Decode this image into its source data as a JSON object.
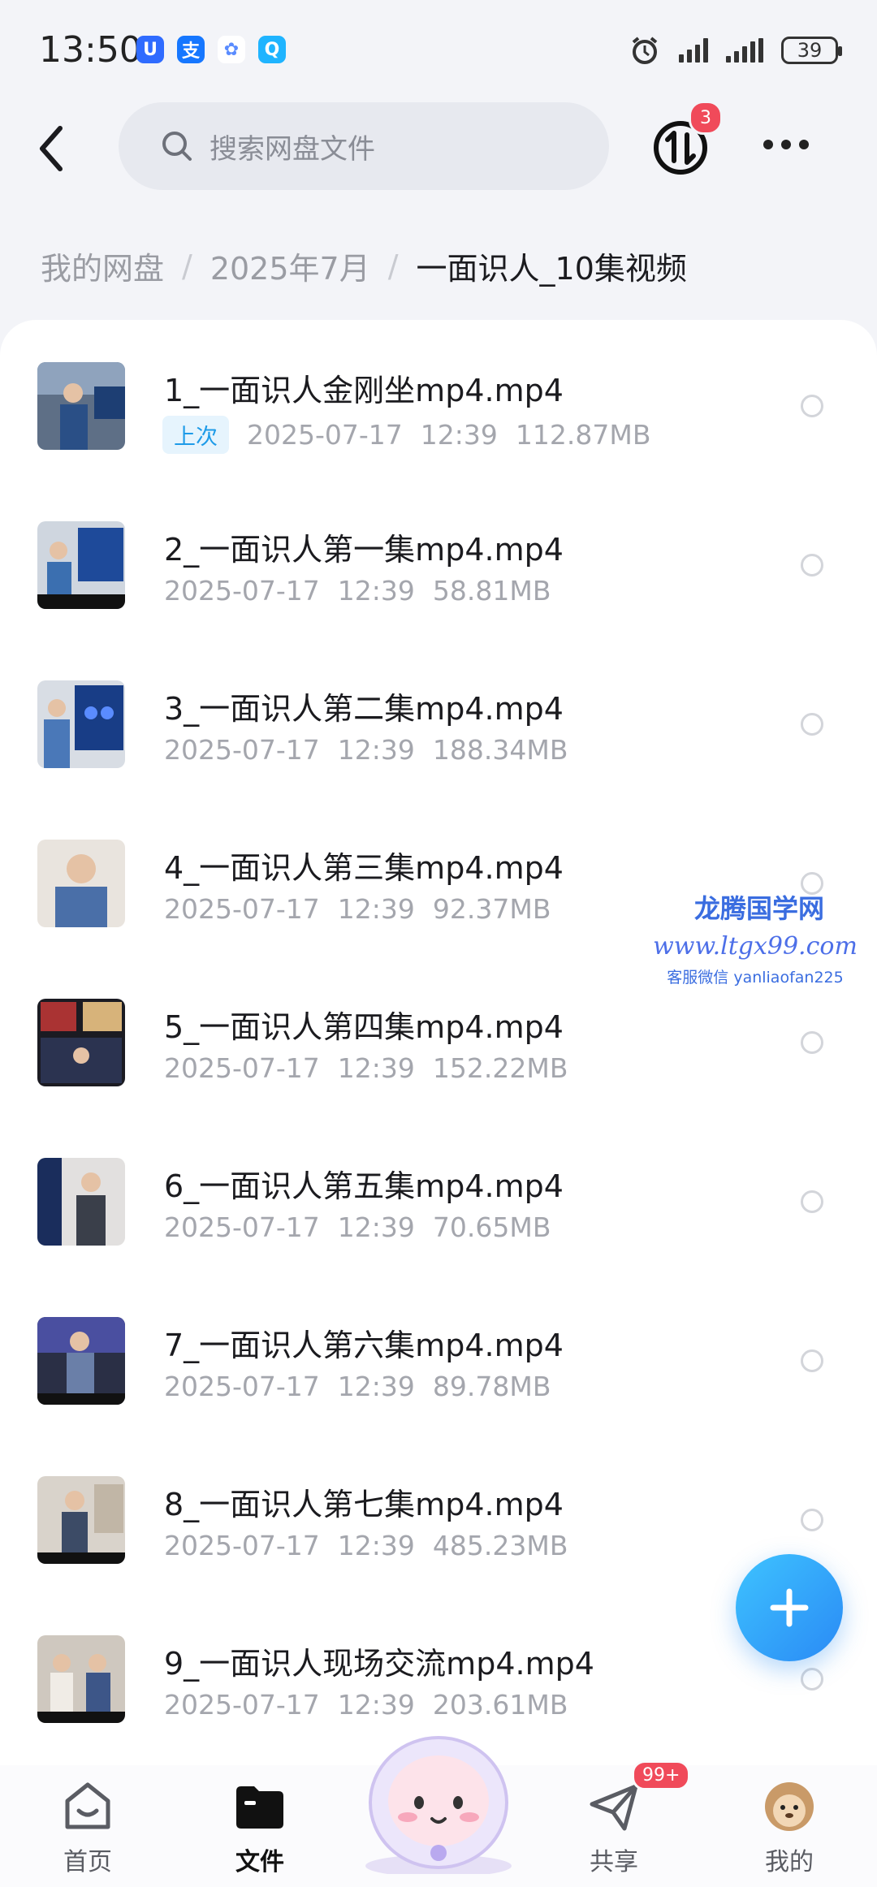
{
  "status_bar": {
    "time": "13:50",
    "app_icons": [
      {
        "name": "baidu-app-icon",
        "glyph": "U",
        "color": "#2f6bff"
      },
      {
        "name": "alipay-app-icon",
        "glyph": "支",
        "color": "#1677ff"
      },
      {
        "name": "cloud-app-icon",
        "glyph": "✿",
        "color": "#ffffff"
      },
      {
        "name": "search-app-icon",
        "glyph": "Q",
        "color": "#1fb4ff"
      }
    ],
    "battery": "39"
  },
  "header": {
    "search_placeholder": "搜索网盘文件",
    "transfer_badge": "3"
  },
  "breadcrumb": {
    "items": [
      "我的网盘",
      "2025年7月"
    ],
    "separator": "/",
    "current": "一面识人_10集视频"
  },
  "files": [
    {
      "name": "1_一面识人金刚坐mp4.mp4",
      "tag": "上次",
      "date": "2025-07-17",
      "time": "12:39",
      "size": "112.87MB"
    },
    {
      "name": "2_一面识人第一集mp4.mp4",
      "date": "2025-07-17",
      "time": "12:39",
      "size": "58.81MB"
    },
    {
      "name": "3_一面识人第二集mp4.mp4",
      "date": "2025-07-17",
      "time": "12:39",
      "size": "188.34MB"
    },
    {
      "name": "4_一面识人第三集mp4.mp4",
      "date": "2025-07-17",
      "time": "12:39",
      "size": "92.37MB"
    },
    {
      "name": "5_一面识人第四集mp4.mp4",
      "date": "2025-07-17",
      "time": "12:39",
      "size": "152.22MB"
    },
    {
      "name": "6_一面识人第五集mp4.mp4",
      "date": "2025-07-17",
      "time": "12:39",
      "size": "70.65MB"
    },
    {
      "name": "7_一面识人第六集mp4.mp4",
      "date": "2025-07-17",
      "time": "12:39",
      "size": "89.78MB"
    },
    {
      "name": "8_一面识人第七集mp4.mp4",
      "date": "2025-07-17",
      "time": "12:39",
      "size": "485.23MB"
    },
    {
      "name": "9_一面识人现场交流mp4.mp4",
      "date": "2025-07-17",
      "time": "12:39",
      "size": "203.61MB"
    }
  ],
  "watermark": {
    "title": "龙腾国学网",
    "url": "www.ltgx99.com",
    "contact": "客服微信 yanliaofan225"
  },
  "nav": {
    "home": "首页",
    "files": "文件",
    "share": "共享",
    "share_badge": "99+",
    "mine": "我的"
  },
  "colors": {
    "accent": "#1e9be8",
    "badge": "#f04a5a",
    "fab": "#2a8af5"
  }
}
